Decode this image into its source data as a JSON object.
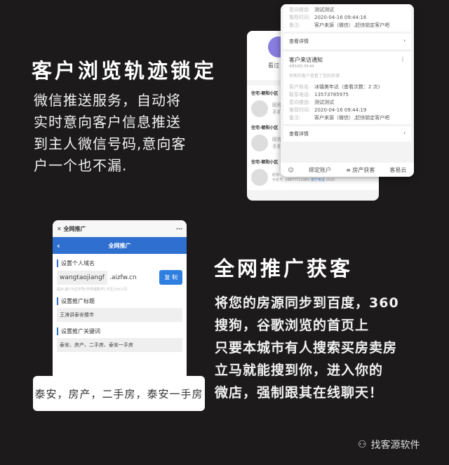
{
  "section1": {
    "title": "客户浏览轨迹锁定",
    "lines": [
      "微信推送服务，自动将",
      "实时意向客户信息推送",
      "到主人微信号码,意向客",
      "户一个也不漏."
    ]
  },
  "back_card": {
    "label": "看过",
    "items": [
      {
        "title": "住宅-朝阳小区",
        "f1": "昵称:",
        "f2": "手机号:"
      },
      {
        "title": "住宅-朝阳小区",
        "f1": "昵称:",
        "f2": "手机号:"
      },
      {
        "title": "住宅-朝阳小区",
        "f1": "昵称: 东方小老婆扫幕啊58472231",
        "f2": "手机号: 18877711985",
        "link1": "查看轨迹",
        "link2": "拨打电话",
        "date": "2020"
      }
    ]
  },
  "front_card": {
    "top": {
      "rows": [
        {
          "label": "意向楼盘:",
          "value": "测试测试"
        },
        {
          "label": "推荐时间:",
          "value": "2020-04-16 09:44:16"
        },
        {
          "label": "备注:",
          "value": "客户来源（微信）,赶快锁定客户吧"
        }
      ]
    },
    "detail_link": "查看详情",
    "notice": {
      "title": "客户来访通知",
      "time": "4月16日 09:44",
      "desc": "有新的客户查看了您的房源",
      "rows": [
        {
          "label": "客户姓名:",
          "value": "冰镇美年达（查看次数：2 次)"
        },
        {
          "label": "联系电话:",
          "value": "13573785975"
        },
        {
          "label": "意向楼盘:",
          "value": "测试测试"
        },
        {
          "label": "推荐时间:",
          "value": "2020-04-16 09:44:19"
        },
        {
          "label": "备注:",
          "value": "客户来源（微信）,赶快锁定客户吧"
        }
      ]
    },
    "tabs": [
      "绑定账户",
      "≡ 房产获客",
      "客易云"
    ]
  },
  "phone": {
    "top_title": "全网推广",
    "nav_title": "全网推广",
    "sec1": "设置个人域名",
    "domain_value": "wangtaojiangf",
    "domain_suffix": ".aizfw.cn",
    "copy": "复 制",
    "hint": "提示:最少5位字符(字母或数字),不区分大小写",
    "sec2": "设置推广标题",
    "title_value": "王涛讲泰安楼市",
    "sec3": "设置推广关键词",
    "keywords_value": "泰安、房产、二手房、泰安一手房"
  },
  "strip_text": "泰安，房产，二手房，泰安一手房",
  "section2": {
    "title": "全网推广获客",
    "lines": [
      "将您的房源同步到百度，360",
      "搜狗，谷歌浏览的首页上",
      "只要本城市有人搜索买房卖房",
      "立马就能搜到你，进入你的",
      "微店，强制跟其在线聊天！"
    ]
  },
  "watermark": "找客源软件"
}
